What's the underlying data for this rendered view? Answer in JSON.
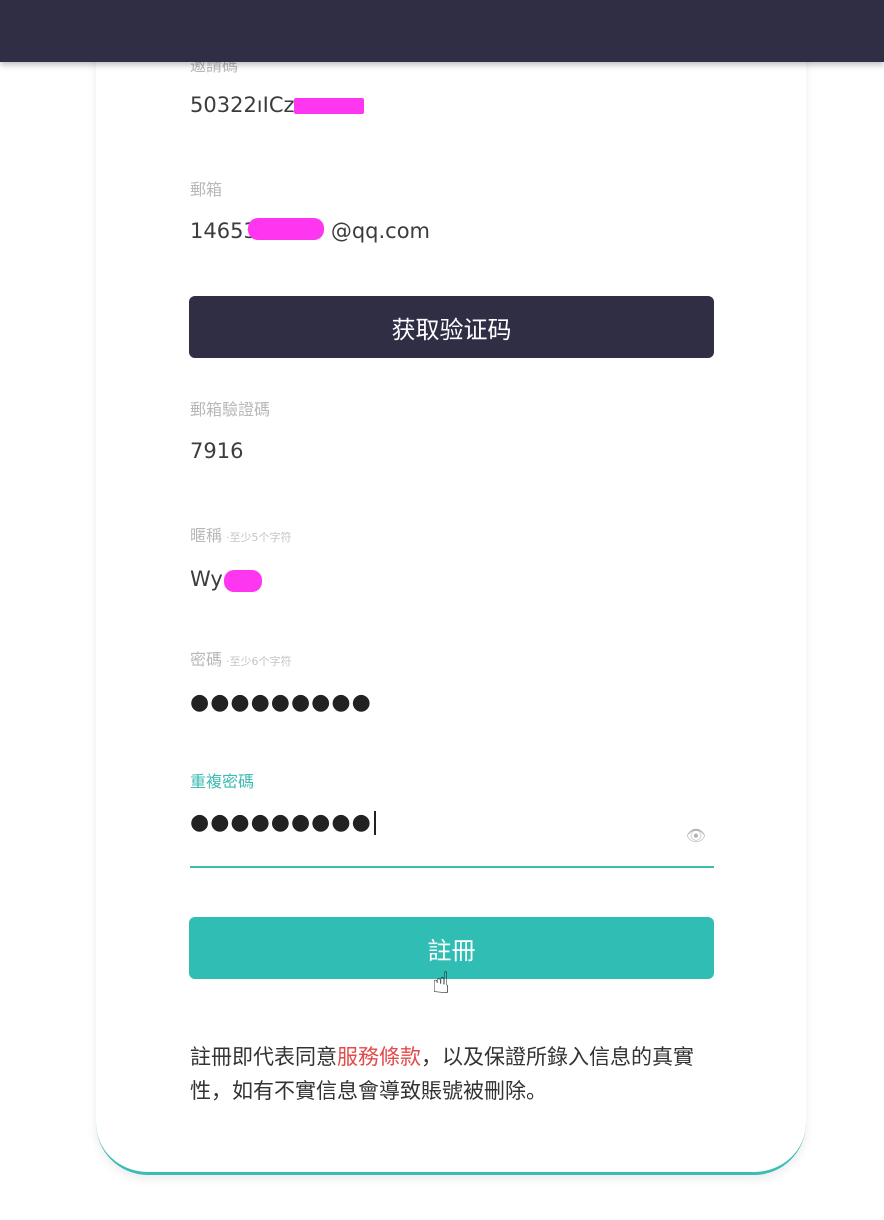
{
  "form": {
    "invite_code": {
      "label": "邀請碼",
      "value": "50322ıICz"
    },
    "email": {
      "label": "郵箱",
      "value_prefix": "14653",
      "value_suffix": "@qq.com"
    },
    "get_code_button": "获取验证码",
    "email_code": {
      "label": "郵箱驗證碼",
      "value": "7916"
    },
    "nickname": {
      "label": "暱稱",
      "hint": "·至少5个字符",
      "value": "Wy"
    },
    "password": {
      "label": "密碼",
      "hint": "·至少6个字符",
      "value": "●●●●●●●●●"
    },
    "confirm_password": {
      "label": "重複密碼",
      "value": "●●●●●●●●●"
    },
    "register_button": "註冊"
  },
  "terms": {
    "prefix": "註冊即代表同意",
    "link": "服務條款",
    "suffix": "，以及保證所錄入信息的真實性，如有不實信息會導致賬號被刪除。"
  },
  "colors": {
    "header": "#2f2e45",
    "accent": "#3cbcb2",
    "link": "#e34a4a",
    "redaction": "#ff36f0"
  },
  "icons": {
    "eye": "eye-icon",
    "cursor": "hand-pointer-cursor"
  }
}
